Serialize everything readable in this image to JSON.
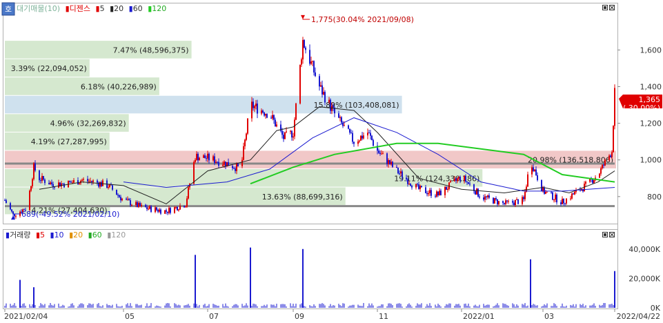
{
  "legend_price": {
    "items": [
      {
        "label": "대기매물(10)",
        "color": "#7fb39a"
      },
      {
        "label": "디젠스",
        "color": "#e00000"
      },
      {
        "label": "5",
        "color": "#e00000"
      },
      {
        "label": "20",
        "color": "#222222"
      },
      {
        "label": "60",
        "color": "#1a1ad0"
      },
      {
        "label": "120",
        "color": "#22cc22"
      }
    ]
  },
  "legend_volume": {
    "items": [
      {
        "label": "거래량",
        "color": "#1a1ad0"
      },
      {
        "label": "5",
        "color": "#e00000"
      },
      {
        "label": "10",
        "color": "#1a1ad0"
      },
      {
        "label": "20",
        "color": "#e09000"
      },
      {
        "label": "60",
        "color": "#22aa22"
      },
      {
        "label": "120",
        "color": "#999999"
      }
    ]
  },
  "corner_button": "호",
  "chart_data": {
    "type": "candlestick",
    "price_axis": {
      "ticks": [
        800,
        1000,
        1200,
        1400,
        1600
      ],
      "labels": [
        "800",
        "1,000",
        "1,200",
        "1,400",
        "1,600"
      ],
      "range": [
        660,
        1850
      ]
    },
    "volume_axis": {
      "ticks": [
        0,
        20000,
        40000
      ],
      "labels": [
        "0K",
        "20,000K",
        "40,000K"
      ],
      "range": [
        0,
        46000
      ]
    },
    "x_labels": [
      "2021/02/04",
      "05",
      "07",
      "09",
      "11",
      "2022/01",
      "03",
      "2022/04/22"
    ],
    "x_label_dates": [
      "2021-02-04",
      "2021-05-01",
      "2021-07-01",
      "2021-09-01",
      "2021-11-01",
      "2022-01-01",
      "2022-03-01",
      "2022-04-22"
    ],
    "date_range": [
      "2021-02-04",
      "2022-04-22"
    ],
    "current_price": {
      "value": "1,365",
      "change": "( 30.00%)"
    },
    "annotations": {
      "high": {
        "text": "1,775(30.04% 2021/09/08)",
        "date": "2021-09-08",
        "price": 1775
      },
      "low": {
        "text": "689(-49.52% 2021/02/10)",
        "date": "2021-02-10",
        "price": 689
      }
    },
    "supply_zones": [
      {
        "label": "7.47% (48,596,375)",
        "percent": 7.47,
        "low": 1550,
        "high": 1650,
        "color": "green"
      },
      {
        "label": "3.39% (22,094,052)",
        "percent": 3.39,
        "low": 1450,
        "high": 1550,
        "color": "green"
      },
      {
        "label": "6.18% (40,226,989)",
        "percent": 6.18,
        "low": 1350,
        "high": 1450,
        "color": "green"
      },
      {
        "label": "15.89% (103,408,081)",
        "percent": 15.89,
        "low": 1250,
        "high": 1350,
        "color": "blue"
      },
      {
        "label": "4.96% (32,269,832)",
        "percent": 4.96,
        "low": 1150,
        "high": 1250,
        "color": "green"
      },
      {
        "label": "4.19% (27,287,995)",
        "percent": 4.19,
        "low": 1050,
        "high": 1150,
        "color": "green"
      },
      {
        "label": "20.98% (136,518,806)",
        "percent": 20.98,
        "low": 950,
        "high": 1050,
        "color": "red"
      },
      {
        "label": "19.11% (124,336,386)",
        "percent": 19.11,
        "low": 850,
        "high": 950,
        "color": "green"
      },
      {
        "label": "13.63% (88,699,316)",
        "percent": 13.63,
        "low": 750,
        "high": 850,
        "color": "green"
      },
      {
        "label": "4.21% (27,404,630)",
        "percent": 4.21,
        "low": 700,
        "high": 750,
        "color": "green"
      }
    ],
    "hlines": [
      {
        "price": 980,
        "color": "#888888"
      },
      {
        "price": 748,
        "color": "#888888"
      }
    ],
    "close_path": [
      [
        "2021-02-04",
        780
      ],
      [
        "2021-02-10",
        700
      ],
      [
        "2021-02-20",
        740
      ],
      [
        "2021-02-25",
        960
      ],
      [
        "2021-03-01",
        900
      ],
      [
        "2021-03-10",
        870
      ],
      [
        "2021-03-20",
        870
      ],
      [
        "2021-04-01",
        890
      ],
      [
        "2021-04-10",
        880
      ],
      [
        "2021-04-20",
        860
      ],
      [
        "2021-05-01",
        780
      ],
      [
        "2021-05-15",
        740
      ],
      [
        "2021-06-01",
        720
      ],
      [
        "2021-06-15",
        760
      ],
      [
        "2021-06-22",
        1020
      ],
      [
        "2021-07-01",
        1010
      ],
      [
        "2021-07-15",
        980
      ],
      [
        "2021-07-25",
        950
      ],
      [
        "2021-08-01",
        1300
      ],
      [
        "2021-08-15",
        1250
      ],
      [
        "2021-08-25",
        1120
      ],
      [
        "2021-09-01",
        1150
      ],
      [
        "2021-09-08",
        1650
      ],
      [
        "2021-09-20",
        1400
      ],
      [
        "2021-10-01",
        1250
      ],
      [
        "2021-10-15",
        1100
      ],
      [
        "2021-10-25",
        1150
      ],
      [
        "2021-11-01",
        1050
      ],
      [
        "2021-11-15",
        940
      ],
      [
        "2021-12-01",
        840
      ],
      [
        "2021-12-15",
        810
      ],
      [
        "2022-01-01",
        910
      ],
      [
        "2022-01-15",
        800
      ],
      [
        "2022-02-01",
        760
      ],
      [
        "2022-02-15",
        780
      ],
      [
        "2022-02-20",
        1000
      ],
      [
        "2022-03-01",
        830
      ],
      [
        "2022-03-15",
        770
      ],
      [
        "2022-04-01",
        860
      ],
      [
        "2022-04-10",
        920
      ],
      [
        "2022-04-20",
        1050
      ],
      [
        "2022-04-22",
        1365
      ]
    ],
    "ma_lines": [
      {
        "name": "20",
        "color": "#222222",
        "points": [
          [
            "2021-03-01",
            840
          ],
          [
            "2021-04-01",
            880
          ],
          [
            "2021-05-01",
            860
          ],
          [
            "2021-06-01",
            760
          ],
          [
            "2021-07-01",
            940
          ],
          [
            "2021-08-01",
            1000
          ],
          [
            "2021-08-20",
            1160
          ],
          [
            "2021-09-01",
            1180
          ],
          [
            "2021-09-20",
            1290
          ],
          [
            "2021-10-15",
            1270
          ],
          [
            "2021-11-01",
            1150
          ],
          [
            "2021-12-01",
            900
          ],
          [
            "2022-01-01",
            840
          ],
          [
            "2022-02-01",
            820
          ],
          [
            "2022-03-01",
            850
          ],
          [
            "2022-03-20",
            820
          ],
          [
            "2022-04-10",
            880
          ],
          [
            "2022-04-22",
            940
          ]
        ]
      },
      {
        "name": "60",
        "color": "#1a1ad0",
        "points": [
          [
            "2021-05-01",
            880
          ],
          [
            "2021-06-01",
            850
          ],
          [
            "2021-07-15",
            880
          ],
          [
            "2021-08-15",
            950
          ],
          [
            "2021-09-15",
            1120
          ],
          [
            "2021-10-15",
            1230
          ],
          [
            "2021-11-15",
            1150
          ],
          [
            "2021-12-15",
            1030
          ],
          [
            "2022-01-15",
            880
          ],
          [
            "2022-02-15",
            830
          ],
          [
            "2022-03-15",
            830
          ],
          [
            "2022-04-22",
            850
          ]
        ]
      },
      {
        "name": "120",
        "color": "#22cc22",
        "points": [
          [
            "2021-08-01",
            870
          ],
          [
            "2021-09-01",
            960
          ],
          [
            "2021-10-01",
            1030
          ],
          [
            "2021-11-15",
            1090
          ],
          [
            "2021-12-15",
            1090
          ],
          [
            "2022-01-15",
            1060
          ],
          [
            "2022-02-15",
            1030
          ],
          [
            "2022-03-15",
            920
          ],
          [
            "2022-04-22",
            880
          ]
        ]
      }
    ],
    "volume_spikes": [
      [
        "2021-02-15",
        19000
      ],
      [
        "2021-02-25",
        14000
      ],
      [
        "2021-06-22",
        36000
      ],
      [
        "2021-08-01",
        41000
      ],
      [
        "2021-09-08",
        40000
      ],
      [
        "2022-02-20",
        33000
      ],
      [
        "2022-04-22",
        25000
      ]
    ]
  }
}
